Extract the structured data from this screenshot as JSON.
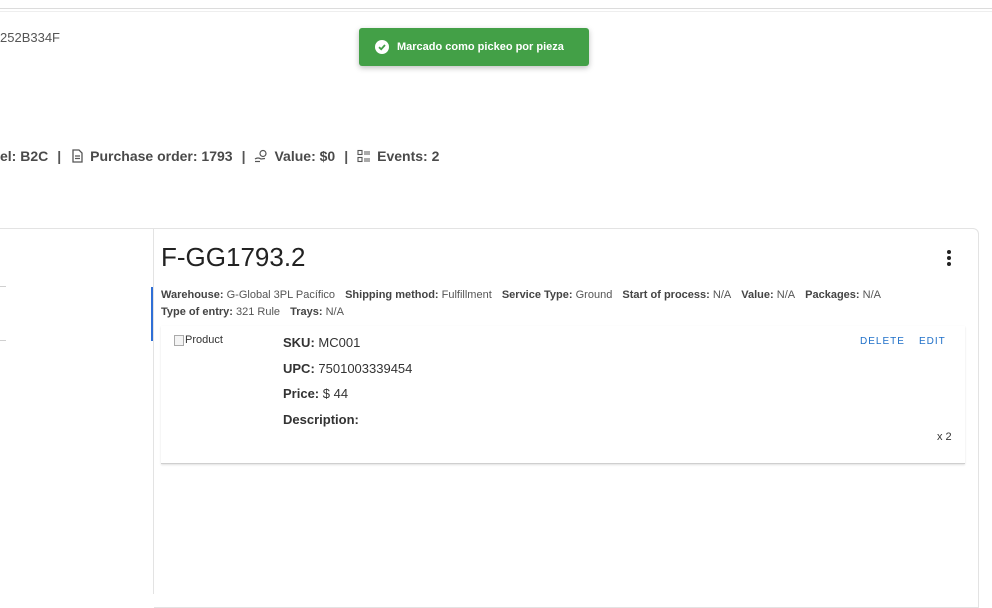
{
  "header": {
    "order_id_fragment": "252B334F"
  },
  "toast": {
    "message": "Marcado como pickeo por pieza",
    "color": "#43a047"
  },
  "summary": {
    "channel": "el: B2C",
    "purchase_order": "Purchase order: 1793",
    "value": "Value: $0",
    "events": "Events: 2",
    "separator": "|"
  },
  "fulfillment": {
    "title": "F-GG1793.2",
    "meta_row1": [
      {
        "label": "Warehouse:",
        "value": "G-Global 3PL Pacífico"
      },
      {
        "label": "Shipping method:",
        "value": "Fulfillment"
      },
      {
        "label": "Service Type:",
        "value": "Ground"
      },
      {
        "label": "Start of process:",
        "value": "N/A"
      },
      {
        "label": "Value:",
        "value": "N/A"
      },
      {
        "label": "Packages:",
        "value": "N/A"
      }
    ],
    "meta_row2": [
      {
        "label": "Type of entry:",
        "value": "321 Rule"
      },
      {
        "label": "Trays:",
        "value": "N/A"
      }
    ]
  },
  "item": {
    "image_alt": "Product",
    "sku_label": "SKU:",
    "sku": "MC001",
    "upc_label": "UPC:",
    "upc": "7501003339454",
    "price_label": "Price:",
    "price": "$ 44",
    "description_label": "Description:",
    "description": "",
    "delete_label": "DELETE",
    "edit_label": "EDIT",
    "quantity": "x 2"
  },
  "colors": {
    "accent": "#2f6fd6",
    "link": "#1e6fc8",
    "success": "#43a047"
  }
}
